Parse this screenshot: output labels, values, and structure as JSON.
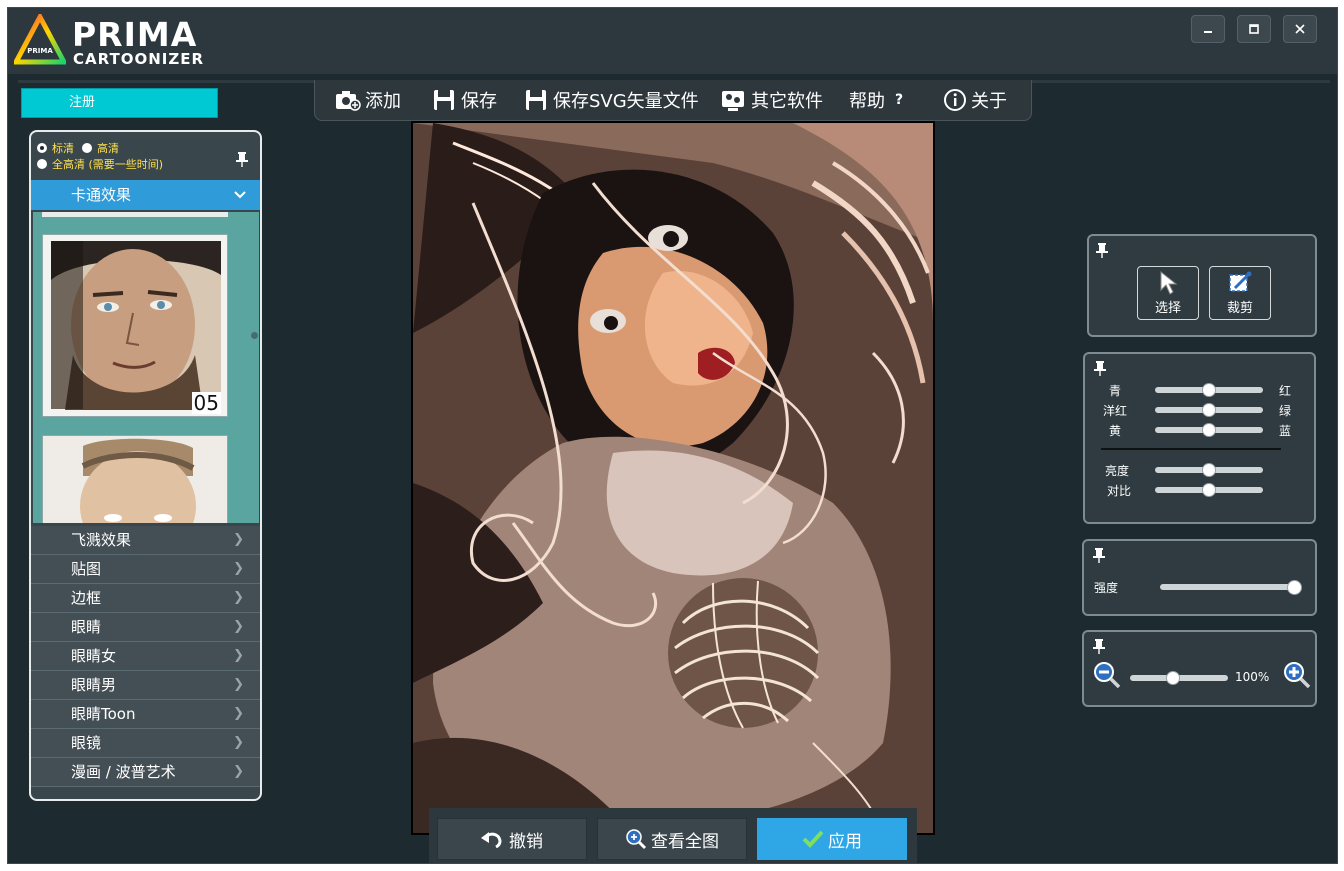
{
  "app": {
    "logo_top": "PRIMA",
    "logo_bottom": "CARTOONIZER",
    "logo_badge": "PRIMA"
  },
  "window_controls": {
    "minimize": "▁",
    "maximize": "□",
    "close": "✕"
  },
  "toolbar": {
    "add": "添加",
    "save": "保存",
    "save_svg": "保存SVG矢量文件",
    "other_software": "其它软件",
    "help": "帮助",
    "help_mark": "?",
    "about": "关于"
  },
  "register": "注册",
  "quality": {
    "standard": "标清",
    "high": "高清",
    "full": "全高清 (需要一些时间)",
    "selected": "standard"
  },
  "effects": {
    "active": "卡通效果",
    "thumbnails": [
      {
        "number": "05"
      }
    ],
    "categories": [
      "飞溅效果",
      "贴图",
      "边框",
      "眼睛",
      "眼睛女",
      "眼睛男",
      "眼睛Toon",
      "眼镜",
      "漫画 / 波普艺术"
    ]
  },
  "tools": {
    "select": "选择",
    "crop": "裁剪"
  },
  "color": {
    "rows": [
      {
        "left": "青",
        "right": "红",
        "value": 0.5
      },
      {
        "left": "洋红",
        "right": "绿",
        "value": 0.5
      },
      {
        "left": "黄",
        "right": "蓝",
        "value": 0.5
      }
    ],
    "brightness": {
      "label": "亮度",
      "value": 0.5
    },
    "contrast": {
      "label": "对比",
      "value": 0.5
    }
  },
  "strength": {
    "label": "强度",
    "value": 1.0
  },
  "zoom": {
    "value": 0.44,
    "label": "100%"
  },
  "bottom": {
    "undo": "撤销",
    "view_full": "查看全图",
    "apply": "应用"
  },
  "colors": {
    "accent_blue": "#2fa6e6",
    "register_cyan": "#00c9d4",
    "thumb_bg": "#5aa5a0",
    "panel_bg": "#2f3b41"
  }
}
